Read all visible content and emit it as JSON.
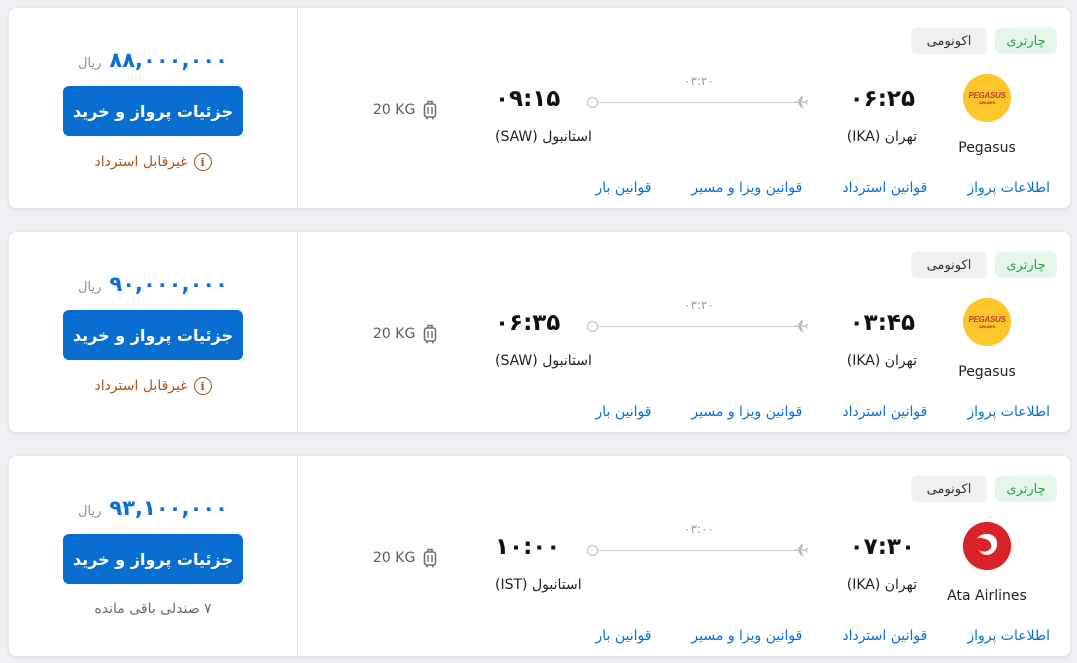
{
  "flights": [
    {
      "tags": {
        "charter": "چارتری",
        "economy": "اکونومی"
      },
      "airline": {
        "name": "Pegasus",
        "logo_text": "PEGASUS",
        "logo_sub": "AIRLINES",
        "logo_type": "pegasus-logo"
      },
      "departure": {
        "time": "۰۶:۲۵",
        "city": "تهران (IKA)"
      },
      "arrival": {
        "time": "۰۹:۱۵",
        "city": "استانبول (SAW)"
      },
      "duration": "۰۳:۲۰",
      "baggage": "20 KG",
      "price": "۸۸,۰۰۰,۰۰۰",
      "currency": "ریال",
      "buy_label": "جزئیات پرواز و خرید",
      "status": "غیرقابل استرداد",
      "links": {
        "info": "اطلاعات پرواز",
        "refund": "قوانین استرداد",
        "visa": "قوانین ویزا و مسیر",
        "baggage": "قوانین بار"
      }
    },
    {
      "tags": {
        "charter": "چارتری",
        "economy": "اکونومی"
      },
      "airline": {
        "name": "Pegasus",
        "logo_text": "PEGASUS",
        "logo_sub": "AIRLINES",
        "logo_type": "pegasus-logo"
      },
      "departure": {
        "time": "۰۳:۴۵",
        "city": "تهران (IKA)"
      },
      "arrival": {
        "time": "۰۶:۳۵",
        "city": "استانبول (SAW)"
      },
      "duration": "۰۳:۲۰",
      "baggage": "20 KG",
      "price": "۹۰,۰۰۰,۰۰۰",
      "currency": "ریال",
      "buy_label": "جزئیات پرواز و خرید",
      "status": "غیرقابل استرداد",
      "links": {
        "info": "اطلاعات پرواز",
        "refund": "قوانین استرداد",
        "visa": "قوانین ویزا و مسیر",
        "baggage": "قوانین بار"
      }
    },
    {
      "tags": {
        "charter": "چارتری",
        "economy": "اکونومی"
      },
      "airline": {
        "name": "Ata Airlines",
        "logo_type": "ata-airlines-logo"
      },
      "departure": {
        "time": "۰۷:۳۰",
        "city": "تهران (IKA)"
      },
      "arrival": {
        "time": "۱۰:۰۰",
        "city": "استانبول (IST)"
      },
      "duration": "۰۳:۰۰",
      "baggage": "20 KG",
      "price": "۹۳,۱۰۰,۰۰۰",
      "currency": "ریال",
      "buy_label": "جزئیات پرواز و خرید",
      "status": "۷ صندلی باقی مانده",
      "links": {
        "info": "اطلاعات پرواز",
        "refund": "قوانین استرداد",
        "visa": "قوانین ویزا و مسیر",
        "baggage": "قوانین بار"
      }
    }
  ],
  "colors": {
    "accent": "#0a6ed1",
    "price": "#0b6fd8",
    "charter_bg": "#e6f6ea",
    "charter_text": "#2e9e4a",
    "non_refundable": "#a8571d"
  }
}
